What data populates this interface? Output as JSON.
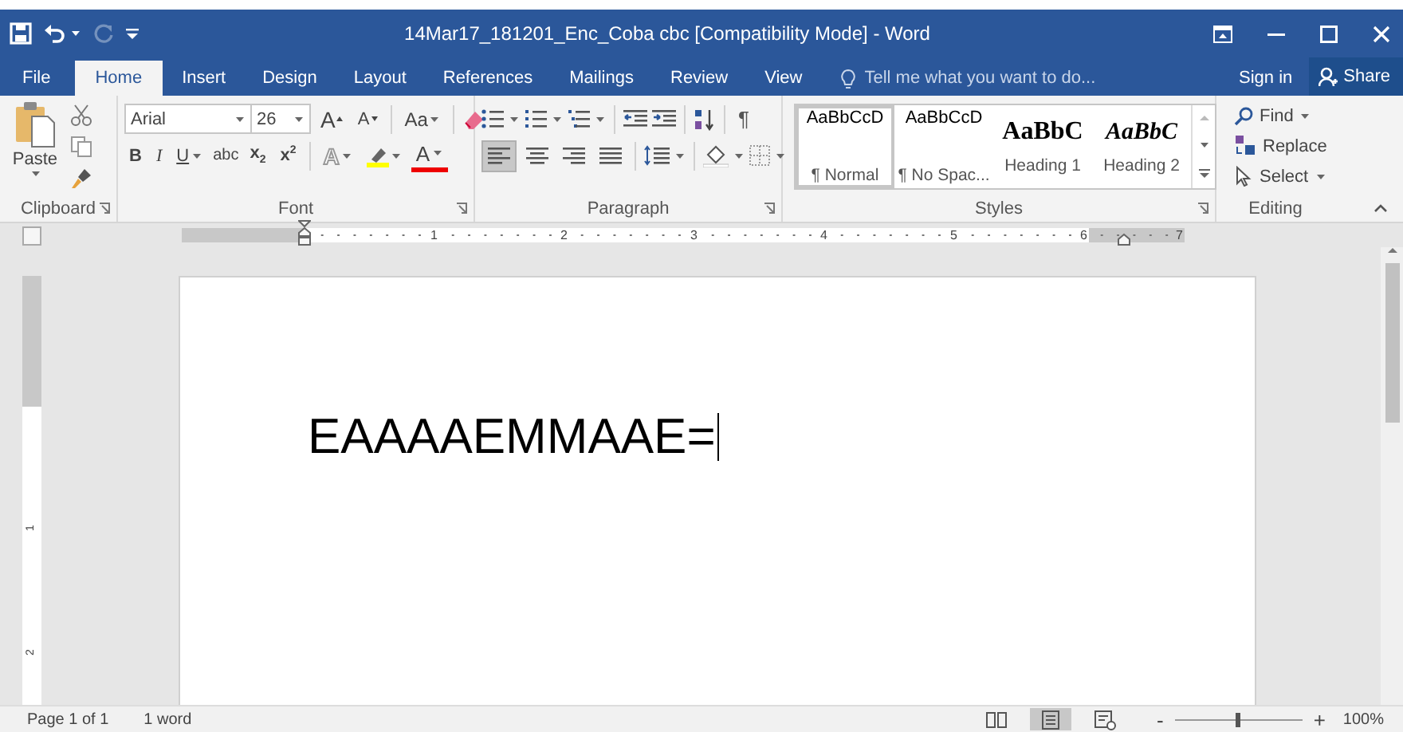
{
  "window": {
    "title": "14Mar17_181201_Enc_Coba cbc [Compatibility Mode] - Word"
  },
  "quick_access": {
    "redo_disabled": true
  },
  "tabs": [
    {
      "label": "File",
      "selected": false
    },
    {
      "label": "Home",
      "selected": true
    },
    {
      "label": "Insert",
      "selected": false
    },
    {
      "label": "Design",
      "selected": false
    },
    {
      "label": "Layout",
      "selected": false
    },
    {
      "label": "References",
      "selected": false
    },
    {
      "label": "Mailings",
      "selected": false
    },
    {
      "label": "Review",
      "selected": false
    },
    {
      "label": "View",
      "selected": false
    }
  ],
  "tell_me": {
    "placeholder": "Tell me what you want to do..."
  },
  "sign_in": "Sign in",
  "share": "Share",
  "ribbon": {
    "clipboard": {
      "label": "Clipboard",
      "paste": "Paste"
    },
    "font": {
      "label": "Font",
      "font_name": "Arial",
      "font_size": "26",
      "grow": "A",
      "shrink": "A",
      "change_case": "Aa",
      "bold": "B",
      "italic": "I",
      "underline": "U",
      "strikethrough": "abc",
      "subscript": "x$_{2}$",
      "superscript": "x$^{2}$",
      "text_effects": "A",
      "font_color": "A"
    },
    "paragraph": {
      "label": "Paragraph",
      "show_marks": "¶",
      "alignments": [
        {
          "kind": "left",
          "selected": true
        },
        {
          "kind": "center",
          "selected": false
        },
        {
          "kind": "right",
          "selected": false
        },
        {
          "kind": "justify",
          "selected": false
        }
      ]
    },
    "styles": {
      "label": "Styles",
      "items": [
        {
          "preview": "AaBbCcD",
          "label": "¶ Normal",
          "kind": "body",
          "selected": true
        },
        {
          "preview": "AaBbCcD",
          "label": "¶ No Spac...",
          "kind": "body",
          "selected": false
        },
        {
          "preview": "AaBbC",
          "label": "Heading 1",
          "kind": "heading1",
          "selected": false
        },
        {
          "preview": "AaBbC",
          "label": "Heading 2",
          "kind": "heading2",
          "selected": false
        }
      ]
    },
    "editing": {
      "label": "Editing",
      "find": "Find",
      "replace": "Replace",
      "select": "Select"
    }
  },
  "ruler": {
    "numbers": [
      "1",
      "2",
      "3",
      "4",
      "5",
      "6",
      "7"
    ]
  },
  "vertical_ruler": {
    "numbers": [
      "1",
      "2"
    ]
  },
  "document": {
    "text": "EAAAAEMMAAE="
  },
  "status_bar": {
    "page": "Page 1 of 1",
    "words": "1 word",
    "views": [
      {
        "kind": "read",
        "selected": false
      },
      {
        "kind": "print",
        "selected": true
      },
      {
        "kind": "web",
        "selected": false
      }
    ],
    "zoom_out": "-",
    "zoom_in": "+",
    "zoom": {
      "level": 0.5
    },
    "zoom_percent": "100%"
  }
}
